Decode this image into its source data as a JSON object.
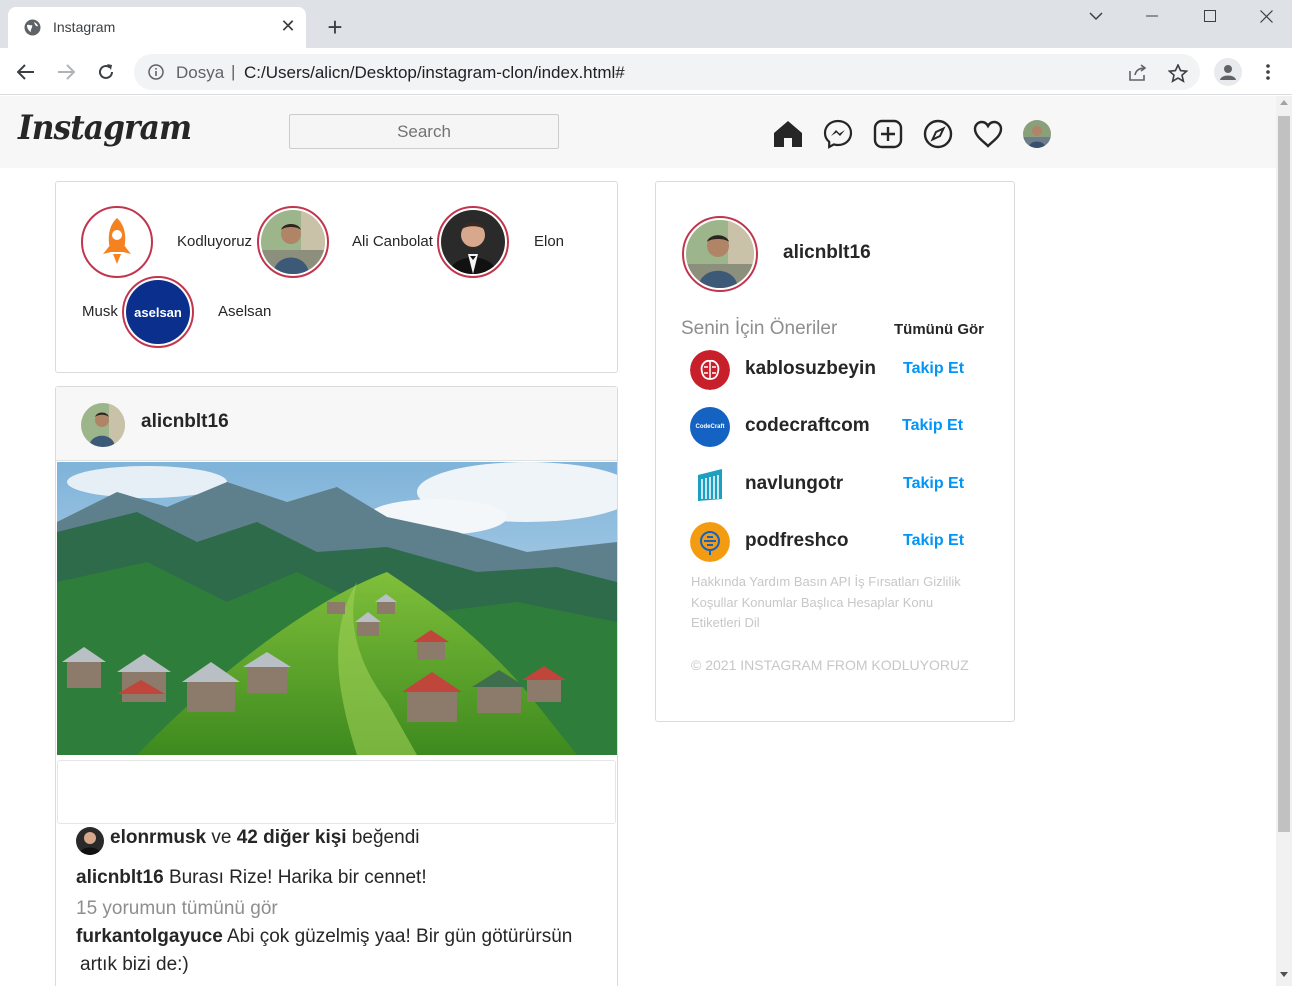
{
  "browser": {
    "tab_title": "Instagram",
    "scheme_label": "Dosya",
    "url": "C:/Users/alicn/Desktop/instagram-clon/index.html#"
  },
  "ig": {
    "logo": "Instagram",
    "search_placeholder": "Search"
  },
  "stories": [
    {
      "name": "Kodluyoruz"
    },
    {
      "name": "Ali Canbolat"
    },
    {
      "name": "Elon"
    },
    {
      "name": "Musk"
    },
    {
      "name": "Aselsan",
      "logo_text": "aselsan"
    }
  ],
  "post": {
    "username": "alicnblt16",
    "likes": {
      "user": "elonrmusk",
      "connector": "ve",
      "others": "42 diğer kişi",
      "suffix": "beğendi"
    },
    "caption": {
      "user": "alicnblt16",
      "text": "Burası Rize! Harika bir cennet!"
    },
    "view_comments": "15 yorumun tümünü gör",
    "comment": {
      "user": "furkantolgayuce",
      "text": "Abi çok güzelmiş yaa! Bir gün götürürsün",
      "text_cont": "artık bizi de:)"
    }
  },
  "sidebar": {
    "username": "alicnblt16",
    "suggestions_title": "Senin İçin Öneriler",
    "see_all": "Tümünü Gör",
    "follow_label": "Takip Et",
    "suggestions": [
      {
        "name": "kablosuzbeyin"
      },
      {
        "name": "codecraftcom",
        "logo_text": "CodeCraft"
      },
      {
        "name": "navlungotr"
      },
      {
        "name": "podfreshco"
      }
    ],
    "footer_links": "Hakkında Yardım Basın API İş Fırsatları Gizlilik Koşullar Konumlar Başlıca Hesaplar Konu Etiketleri Dil",
    "copyright": "© 2021 INSTAGRAM FROM KODLUYORUZ"
  },
  "colors": {
    "story_ring": "#c1354e",
    "follow": "#0095f6",
    "aselsan": "#0a2f8c"
  }
}
